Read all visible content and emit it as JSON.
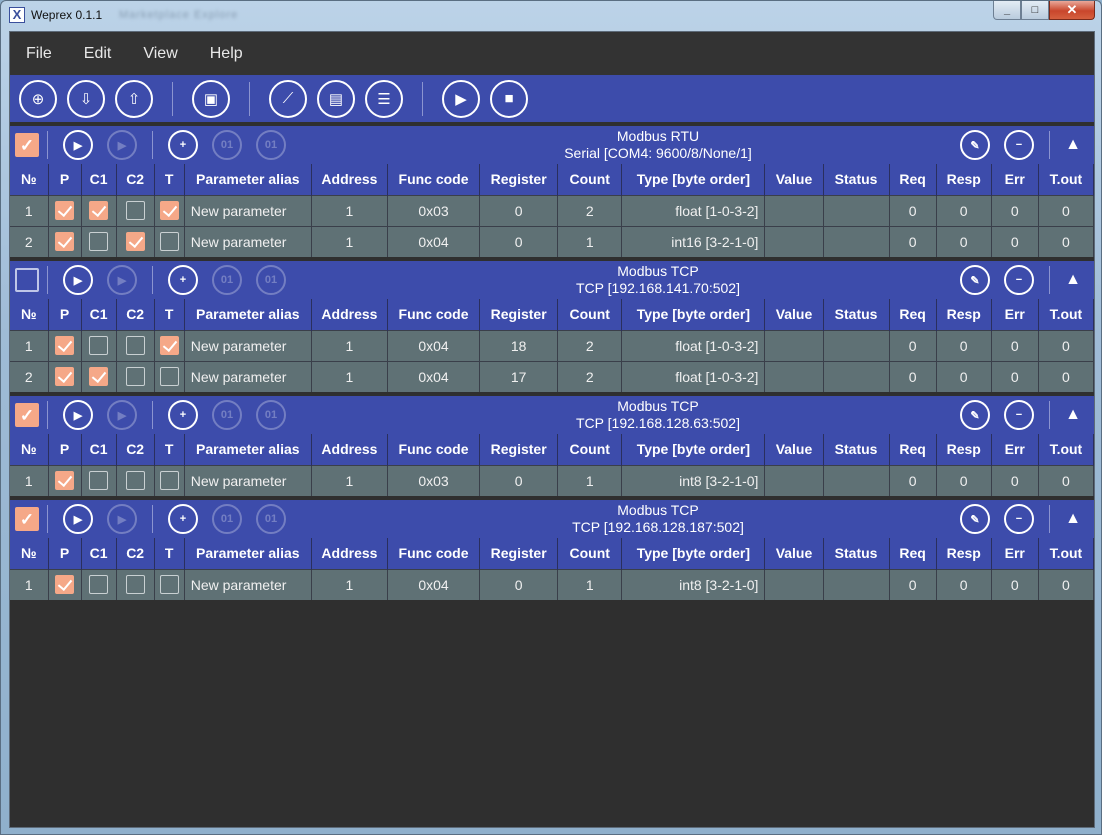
{
  "window": {
    "title": "Weprex 0.1.1",
    "title_extra": "Marketplace   Explore",
    "min": "_",
    "max": "□",
    "close": "✕"
  },
  "menu": [
    "File",
    "Edit",
    "View",
    "Help"
  ],
  "toolbar": {
    "buttons": [
      {
        "name": "new-project-icon",
        "glyph": "⊕"
      },
      {
        "name": "open-project-icon",
        "glyph": "⇩"
      },
      {
        "name": "save-project-icon",
        "glyph": "⇧"
      },
      {
        "name": "add-device-icon",
        "glyph": "▣"
      },
      {
        "name": "chart-view-icon",
        "glyph": "⟋"
      },
      {
        "name": "table-view-icon",
        "glyph": "▤"
      },
      {
        "name": "list-view-icon",
        "glyph": "☰"
      },
      {
        "name": "start-polling-icon",
        "glyph": "▶"
      },
      {
        "name": "stop-polling-icon",
        "glyph": "■"
      }
    ]
  },
  "columns": [
    "№",
    "P",
    "C1",
    "C2",
    "T",
    "Parameter alias",
    "Address",
    "Func code",
    "Register",
    "Count",
    "Type [byte order]",
    "Value",
    "Status",
    "Req",
    "Resp",
    "Err",
    "T.out"
  ],
  "groups": [
    {
      "checked": true,
      "protocol": "Modbus RTU",
      "connection": "Serial [COM4: 9600/8/None/1]",
      "rows": [
        {
          "n": "1",
          "p": true,
          "c1": true,
          "c2": false,
          "t": true,
          "alias": "New parameter",
          "address": "1",
          "func": "0x03",
          "register": "0",
          "count": "2",
          "type": "float [1-0-3-2]",
          "value": "",
          "status": "",
          "req": "0",
          "resp": "0",
          "err": "0",
          "tout": "0"
        },
        {
          "n": "2",
          "p": true,
          "c1": false,
          "c2": true,
          "t": false,
          "alias": "New parameter",
          "address": "1",
          "func": "0x04",
          "register": "0",
          "count": "1",
          "type": "int16 [3-2-1-0]",
          "value": "",
          "status": "",
          "req": "0",
          "resp": "0",
          "err": "0",
          "tout": "0"
        }
      ]
    },
    {
      "checked": false,
      "protocol": "Modbus TCP",
      "connection": "TCP [192.168.141.70:502]",
      "rows": [
        {
          "n": "1",
          "p": true,
          "c1": false,
          "c2": false,
          "t": true,
          "alias": "New parameter",
          "address": "1",
          "func": "0x04",
          "register": "18",
          "count": "2",
          "type": "float [1-0-3-2]",
          "value": "",
          "status": "",
          "req": "0",
          "resp": "0",
          "err": "0",
          "tout": "0"
        },
        {
          "n": "2",
          "p": true,
          "c1": true,
          "c2": false,
          "t": false,
          "alias": "New parameter",
          "address": "1",
          "func": "0x04",
          "register": "17",
          "count": "2",
          "type": "float [1-0-3-2]",
          "value": "",
          "status": "",
          "req": "0",
          "resp": "0",
          "err": "0",
          "tout": "0"
        }
      ]
    },
    {
      "checked": true,
      "protocol": "Modbus TCP",
      "connection": "TCP [192.168.128.63:502]",
      "rows": [
        {
          "n": "1",
          "p": true,
          "c1": false,
          "c2": false,
          "t": false,
          "alias": "New parameter",
          "address": "1",
          "func": "0x03",
          "register": "0",
          "count": "1",
          "type": "int8 [3-2-1-0]",
          "value": "",
          "status": "",
          "req": "0",
          "resp": "0",
          "err": "0",
          "tout": "0"
        }
      ]
    },
    {
      "checked": true,
      "protocol": "Modbus TCP",
      "connection": "TCP [192.168.128.187:502]",
      "rows": [
        {
          "n": "1",
          "p": true,
          "c1": false,
          "c2": false,
          "t": false,
          "alias": "New parameter",
          "address": "1",
          "func": "0x04",
          "register": "0",
          "count": "1",
          "type": "int8 [3-2-1-0]",
          "value": "",
          "status": "",
          "req": "0",
          "resp": "0",
          "err": "0",
          "tout": "0"
        }
      ]
    }
  ],
  "group_icons": {
    "start": "▶",
    "stop": "▶",
    "add": "+",
    "remove": "01",
    "edit": "01",
    "settings": "✎",
    "delete": "−",
    "collapse": "▲"
  },
  "colors": {
    "accent": "#3d4cab",
    "checked": "#f5a888",
    "row_bg": "#5f7175",
    "background": "#2f2f2f"
  }
}
